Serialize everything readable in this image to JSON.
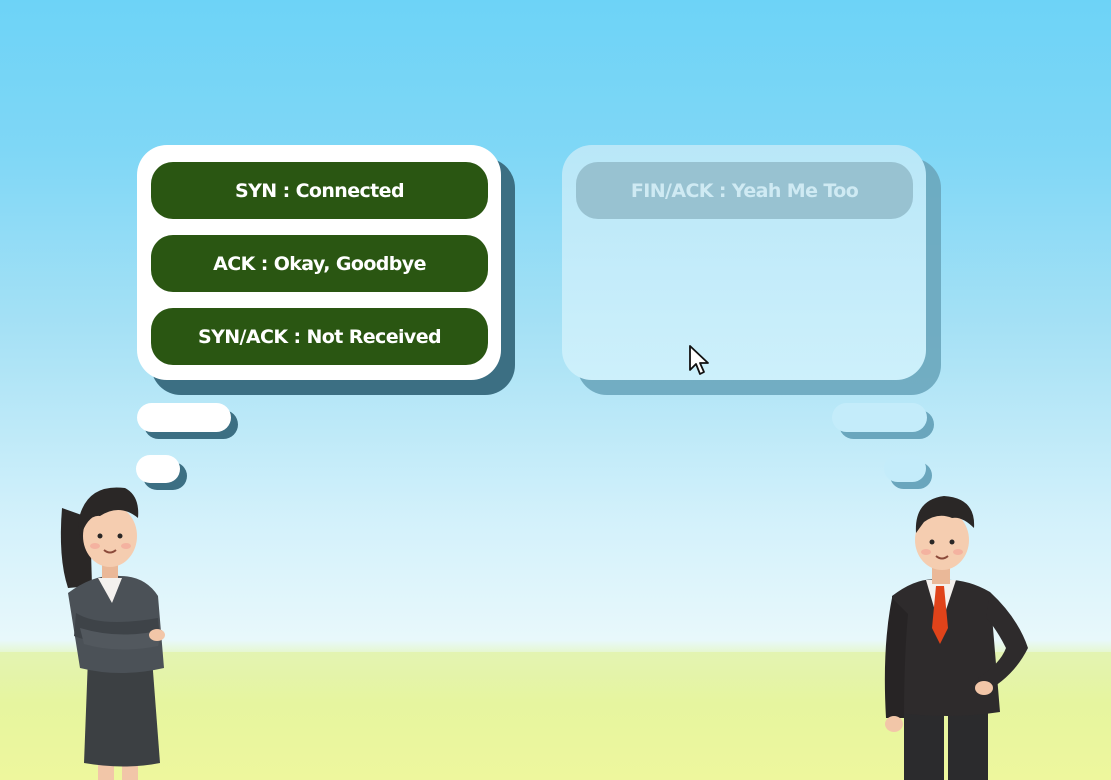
{
  "scene": {
    "colors": {
      "sky_top": "#6dd3f7",
      "sky_bottom": "#e8f8fb",
      "grass": "#eef79d",
      "answer_green": "#2a5612",
      "answer_faded": "#98c2d1"
    }
  },
  "left_bubble": {
    "options": [
      {
        "label": "SYN : Connected"
      },
      {
        "label": "ACK : Okay, Goodbye"
      },
      {
        "label": "SYN/ACK : Not Received"
      }
    ]
  },
  "right_bubble": {
    "message": "FIN/ACK : Yeah Me Too"
  },
  "icons": {
    "cursor": "mouse-pointer-icon",
    "woman": "businesswoman-character",
    "man": "businessman-character"
  }
}
